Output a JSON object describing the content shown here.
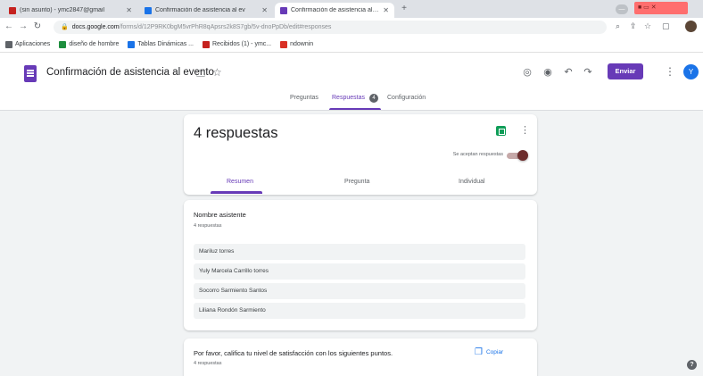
{
  "browser": {
    "tabs": [
      {
        "title": "(sin asunto) - ymc2847@gmail",
        "favicon_color": "#c5221f"
      },
      {
        "title": "Confirmación de asistencia al ev",
        "favicon_color": "#1a73e8"
      },
      {
        "title": "Confirmación de asistencia al ev",
        "favicon_color": "#673ab7"
      }
    ],
    "new_tab": "+",
    "url_host": "docs.google.com",
    "url_path": "/forms/d/12P9RK0bgM5vrPhR8qApsrs2k8S7gb/5v-dnoPpDb/edit#responses",
    "bookmarks": [
      {
        "label": "Aplicaciones",
        "color": "#5f6368"
      },
      {
        "label": "diseño de hombre",
        "color": "#1e8e3e"
      },
      {
        "label": "Tablas Dinámicas ...",
        "color": "#1a73e8"
      },
      {
        "label": "Recibidos (1) - ymc...",
        "color": "#c5221f"
      },
      {
        "label": "ndownin",
        "color": "#d93025"
      }
    ]
  },
  "header": {
    "title": "Confirmación de asistencia al evento",
    "send_label": "Enviar",
    "avatar_letter": "Y",
    "tabs": [
      {
        "label": "Preguntas"
      },
      {
        "label": "Respuestas"
      },
      {
        "label": "Configuración"
      }
    ],
    "responses_badge": "4"
  },
  "summary": {
    "count_label": "4 respuestas",
    "accepting_label": "Se aceptan respuestas",
    "tabs": [
      {
        "label": "Resumen"
      },
      {
        "label": "Pregunta"
      },
      {
        "label": "Individual"
      }
    ]
  },
  "names_question": {
    "title": "Nombre asistente",
    "sub": "4 respuestas",
    "answers": [
      "Mariluz torres",
      "Yuly Marcela Carrillo torres",
      "Socorro Sarmiento Santos",
      "Liliana Rondón Sarmiento"
    ]
  },
  "satisfaction_question": {
    "title": "Por favor, califica tu nivel de satisfacción con los siguientes puntos.",
    "sub": "4 respuestas",
    "copy_label": "Copiar"
  },
  "colors": {
    "accent": "#673ab7",
    "sheets": "#0f9d58",
    "link": "#1a73e8"
  }
}
